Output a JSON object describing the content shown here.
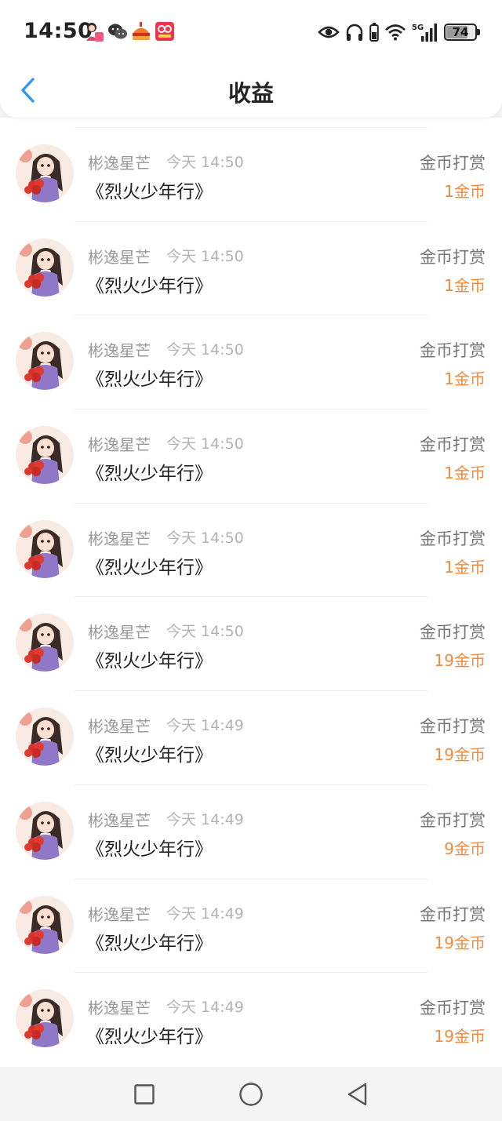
{
  "status_bar": {
    "time": "14:50",
    "notification_icons": [
      "user-app-icon",
      "wechat-icon",
      "food-app-icon",
      "video-app-icon"
    ],
    "system_icons": [
      "eye-icon",
      "headphones-icon",
      "battery-small-icon",
      "wifi-icon",
      "signal-5g-icon",
      "battery-icon"
    ],
    "signal_label": "5G",
    "battery_level": "74"
  },
  "header": {
    "title": "收益",
    "back_icon": "chevron-left-icon",
    "accent_color": "#2d9bf0"
  },
  "records": [
    {
      "name": "彬逸星芒",
      "time": "今天 14:50",
      "work": "《烈火少年行》",
      "kind": "金币打赏",
      "amount": "1金币"
    },
    {
      "name": "彬逸星芒",
      "time": "今天 14:50",
      "work": "《烈火少年行》",
      "kind": "金币打赏",
      "amount": "1金币"
    },
    {
      "name": "彬逸星芒",
      "time": "今天 14:50",
      "work": "《烈火少年行》",
      "kind": "金币打赏",
      "amount": "1金币"
    },
    {
      "name": "彬逸星芒",
      "time": "今天 14:50",
      "work": "《烈火少年行》",
      "kind": "金币打赏",
      "amount": "1金币"
    },
    {
      "name": "彬逸星芒",
      "time": "今天 14:50",
      "work": "《烈火少年行》",
      "kind": "金币打赏",
      "amount": "1金币"
    },
    {
      "name": "彬逸星芒",
      "time": "今天 14:50",
      "work": "《烈火少年行》",
      "kind": "金币打赏",
      "amount": "19金币"
    },
    {
      "name": "彬逸星芒",
      "time": "今天 14:49",
      "work": "《烈火少年行》",
      "kind": "金币打赏",
      "amount": "19金币"
    },
    {
      "name": "彬逸星芒",
      "time": "今天 14:49",
      "work": "《烈火少年行》",
      "kind": "金币打赏",
      "amount": "9金币"
    },
    {
      "name": "彬逸星芒",
      "time": "今天 14:49",
      "work": "《烈火少年行》",
      "kind": "金币打赏",
      "amount": "19金币"
    },
    {
      "name": "彬逸星芒",
      "time": "今天 14:49",
      "work": "《烈火少年行》",
      "kind": "金币打赏",
      "amount": "19金币"
    }
  ],
  "colors": {
    "amount": "#f08a3c",
    "name": "#999999",
    "work": "#222222"
  },
  "nav_bar": {
    "buttons": [
      "recent-apps-square-icon",
      "home-circle-icon",
      "back-triangle-icon"
    ]
  }
}
